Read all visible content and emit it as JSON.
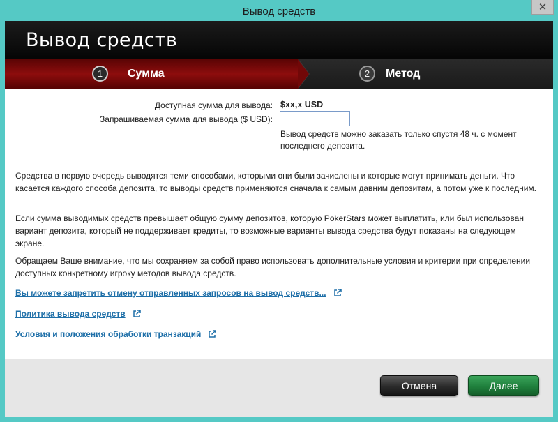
{
  "window": {
    "title": "Вывод средств",
    "close_symbol": "✕"
  },
  "header": {
    "title": "Вывод средств"
  },
  "steps": [
    {
      "number": "1",
      "label": "Сумма",
      "active": true
    },
    {
      "number": "2",
      "label": "Метод",
      "active": false
    }
  ],
  "form": {
    "available_label": "Доступная сумма для вывода:",
    "available_value": "$xx,x USD",
    "requested_label": "Запрашиваемая сумма для вывода ($ USD):",
    "requested_value": "",
    "hint": "Вывод средств можно заказать только спустя 48 ч. с момент последнего депозита."
  },
  "info": {
    "paragraph1": "Средства в первую очередь выводятся теми способами, которыми они были зачислены и которые могут принимать деньги. Что касается каждого способа депозита, то выводы средств применяются сначала к самым давним депозитам, а потом уже к последним.",
    "paragraph2": "Если сумма выводимых средств превышает общую сумму депозитов, которую PokerStars может выплатить, или был использован вариант депозита, который не поддерживает кредиты, то возможные варианты вывода средства будут показаны на следующем экране.",
    "paragraph3": "Обращаем Ваше внимание, что мы сохраняем за собой право использовать дополнительные условия и критерии при определении доступных конкретному игроку методов вывода средств."
  },
  "links": [
    {
      "label": "Вы можете запретить отмену отправленных запросов на вывод средств...",
      "icon": "external-link-icon"
    },
    {
      "label": "Политика вывода средств",
      "icon": "external-link-icon"
    },
    {
      "label": "Условия и положения обработки транзакций",
      "icon": "external-link-icon"
    }
  ],
  "buttons": {
    "cancel": "Отмена",
    "next": "Далее"
  },
  "colors": {
    "frame": "#55c9c5",
    "active_step": "#8d0d0d",
    "link": "#1e6fa8",
    "next_button": "#1f7f3c"
  }
}
